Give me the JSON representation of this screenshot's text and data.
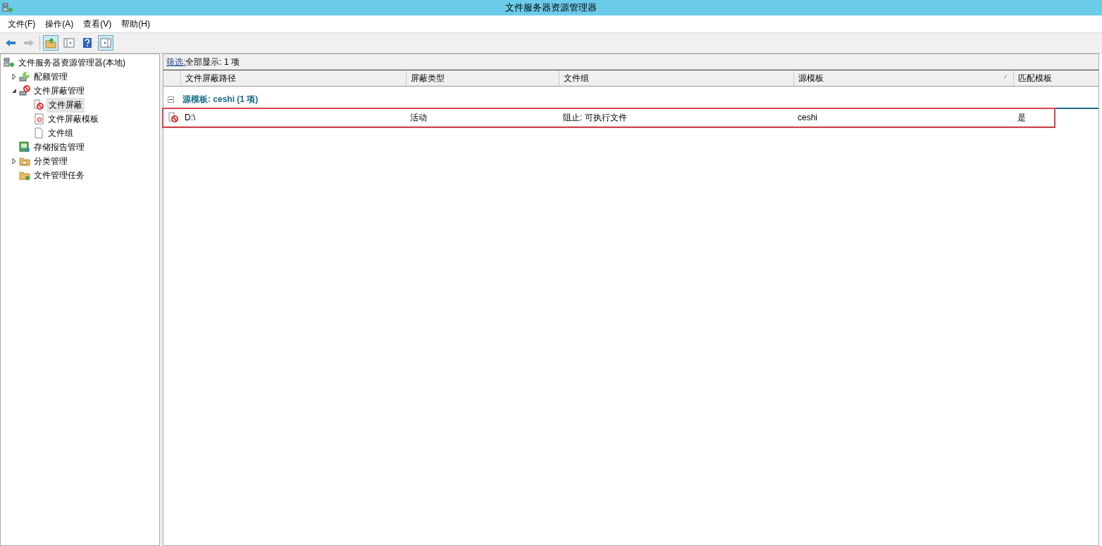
{
  "window": {
    "title": "文件服务器资源管理器"
  },
  "menu": [
    {
      "label": "文件(F)"
    },
    {
      "label": "操作(A)"
    },
    {
      "label": "查看(V)"
    },
    {
      "label": "帮助(H)"
    }
  ],
  "toolbar": [
    {
      "kind": "back",
      "disabled": false,
      "pressed": false
    },
    {
      "kind": "forward",
      "disabled": true,
      "pressed": false
    },
    {
      "kind": "separator"
    },
    {
      "kind": "up",
      "disabled": false,
      "pressed": true
    },
    {
      "kind": "tree",
      "disabled": false,
      "pressed": false
    },
    {
      "kind": "help",
      "disabled": false,
      "pressed": false
    },
    {
      "kind": "pane",
      "disabled": false,
      "pressed": true
    }
  ],
  "tree": [
    {
      "label": "文件服务器资源管理器(本地)",
      "kind": "server",
      "selected": false,
      "children": [
        {
          "label": "配额管理",
          "kind": "quota",
          "selected": false,
          "expanded": false
        },
        {
          "label": "文件屏蔽管理",
          "kind": "screen",
          "selected": false,
          "expanded": true,
          "children": [
            {
              "label": "文件屏蔽",
              "kind": "screen-item",
              "selected": true
            },
            {
              "label": "文件屏蔽模板",
              "kind": "template",
              "selected": false
            },
            {
              "label": "文件组",
              "kind": "file-group",
              "selected": false
            }
          ]
        },
        {
          "label": "存储报告管理",
          "kind": "report",
          "selected": false
        },
        {
          "label": "分类管理",
          "kind": "classification",
          "selected": false,
          "expanded": false
        },
        {
          "label": "文件管理任务",
          "kind": "task",
          "selected": false
        }
      ]
    }
  ],
  "filter": {
    "link": "筛选:",
    "text": "全部显示: 1 项"
  },
  "table": {
    "columns": [
      {
        "label": "文件屏蔽路径",
        "sorted": false
      },
      {
        "label": "屏蔽类型",
        "sorted": false
      },
      {
        "label": "文件组",
        "sorted": false
      },
      {
        "label": "源模板",
        "sorted": true
      },
      {
        "label": "匹配模板",
        "sorted": false
      }
    ],
    "groups": [
      {
        "label": "源模板: ceshi (1 项)",
        "expanded": true,
        "rows": [
          {
            "cells": [
              "D:\\",
              "活动",
              "阻止: 可执行文件",
              "ceshi",
              "是"
            ],
            "highlighted": true
          }
        ]
      }
    ]
  }
}
